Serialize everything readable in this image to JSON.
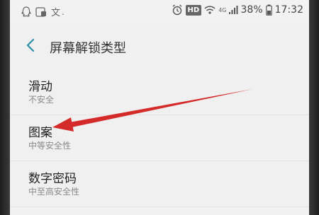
{
  "status_bar": {
    "left_icons": [
      "qq-icon",
      "gallery-icon",
      "text-icon"
    ],
    "left_text_glyph": "文",
    "hd_badge": "HD",
    "network": "4G",
    "battery_percent": "38%",
    "time": "17:32"
  },
  "header": {
    "title": "屏幕解锁类型"
  },
  "lock_types": {
    "items": [
      {
        "title": "滑动",
        "subtitle": "不安全"
      },
      {
        "title": "图案",
        "subtitle": "中等安全性"
      },
      {
        "title": "数字密码",
        "subtitle": "中至高安全性"
      }
    ]
  },
  "colors": {
    "background": "#f0f0f0",
    "arrow": "#d42a2a",
    "back_arrow": "#2d8fa6",
    "subtitle": "#8a8a8a"
  },
  "icons": {
    "back": "back-arrow-icon",
    "alarm": "alarm-icon",
    "wifi": "wifi-icon",
    "signal": "signal-icon",
    "battery": "battery-icon"
  }
}
